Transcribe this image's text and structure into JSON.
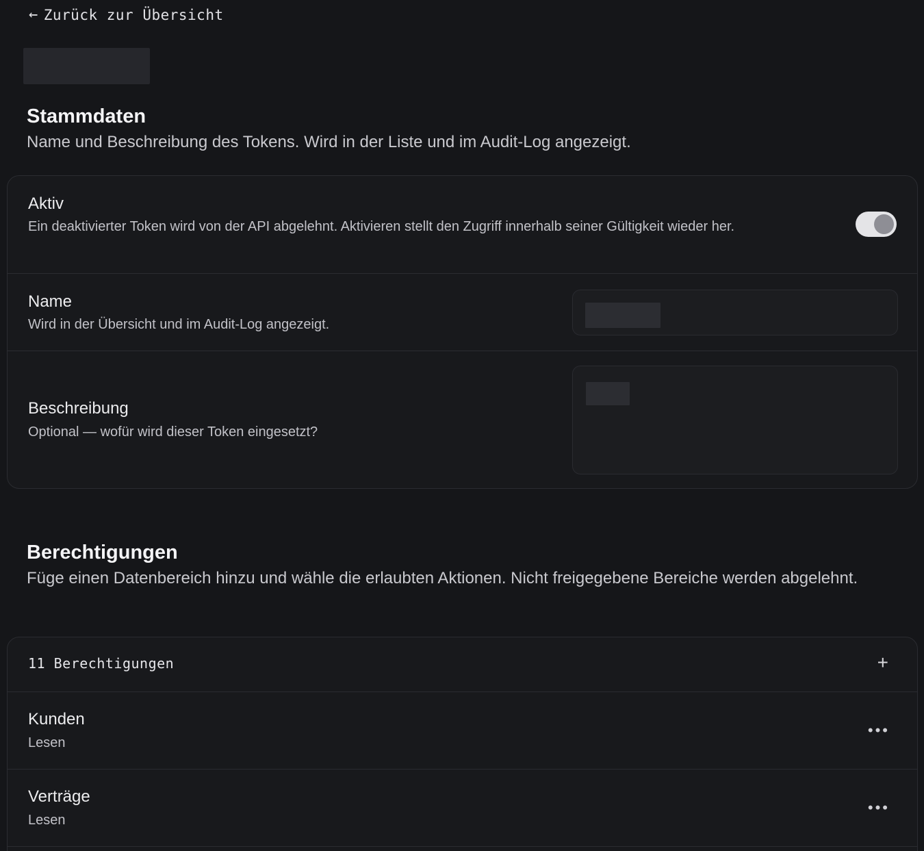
{
  "nav": {
    "back_icon": "arrow-left-icon",
    "back_label": "Zurück zur Übersicht"
  },
  "stammdaten": {
    "title": "Stammdaten",
    "description": "Name und Beschreibung des Tokens. Wird in der Liste und im Audit-Log angezeigt.",
    "active": {
      "label": "Aktiv",
      "description": "Ein deaktivierter Token wird von der API abgelehnt. Aktivieren stellt den Zugriff innerhalb seiner Gültigkeit wieder her.",
      "enabled": true
    },
    "name": {
      "label": "Name",
      "description": "Wird in der Übersicht und im Audit-Log angezeigt."
    },
    "beschreibung": {
      "label": "Beschreibung",
      "description": "Optional — wofür wird dieser Token eingesetzt?"
    }
  },
  "berechtigungen": {
    "title": "Berechtigungen",
    "description": "Füge einen Datenbereich hinzu und wähle die erlaubten Aktionen. Nicht freigegebene Bereiche werden abgelehnt.",
    "count_label": "11 Berechtigungen",
    "add_icon": "plus-icon",
    "more_icon": "more-horizontal-icon",
    "items": [
      {
        "name": "Kunden",
        "access": "Lesen"
      },
      {
        "name": "Verträge",
        "access": "Lesen"
      }
    ]
  },
  "colors": {
    "background": "#151619",
    "card": "#18191c",
    "border": "#2b2c31",
    "toggle_track": "#e4e4e7",
    "toggle_knob": "#8e8e95"
  }
}
